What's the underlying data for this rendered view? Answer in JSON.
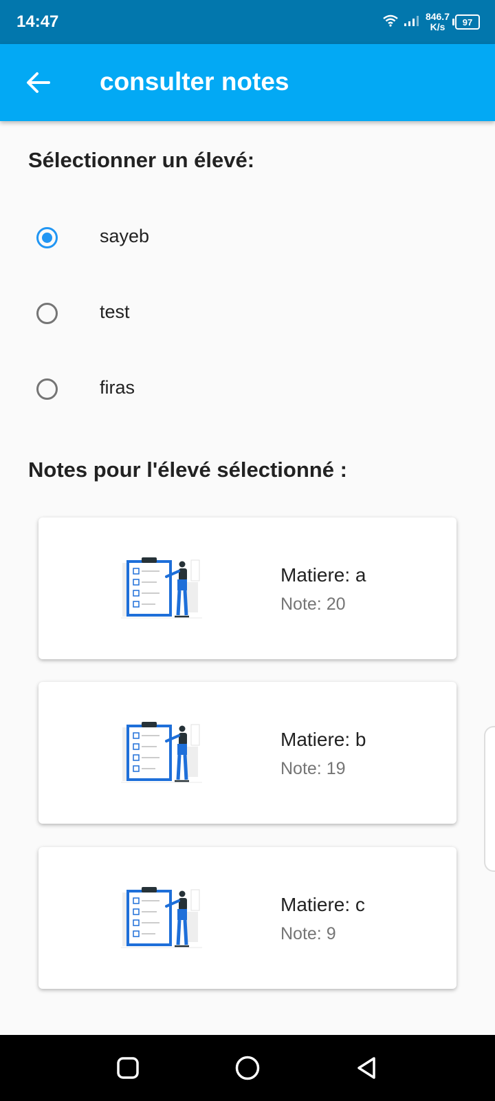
{
  "status_bar": {
    "time": "14:47",
    "speed_value": "846.7",
    "speed_unit": "K/s",
    "battery": "97"
  },
  "app_bar": {
    "title": "consulter notes",
    "back_icon": "arrow-left-icon"
  },
  "select_section": {
    "title": "Sélectionner un élevé:",
    "options": [
      {
        "label": "sayeb",
        "checked": true
      },
      {
        "label": "test",
        "checked": false
      },
      {
        "label": "firas",
        "checked": false
      }
    ]
  },
  "notes_section": {
    "title": "Notes pour l'élevé sélectionné :",
    "cards": [
      {
        "matiere": "Matiere: a",
        "note": "Note: 20"
      },
      {
        "matiere": "Matiere: b",
        "note": "Note: 19"
      },
      {
        "matiere": "Matiere: c",
        "note": "Note: 9"
      }
    ]
  },
  "colors": {
    "status_bar": "#0277ad",
    "app_bar": "#03a9f4",
    "radio_checked": "#2196f3",
    "radio_unchecked": "#757575",
    "illustration_blue": "#1e6fd9"
  },
  "nav_bar": {
    "icons": [
      "square-icon",
      "circle-icon",
      "back-triangle-icon"
    ]
  }
}
